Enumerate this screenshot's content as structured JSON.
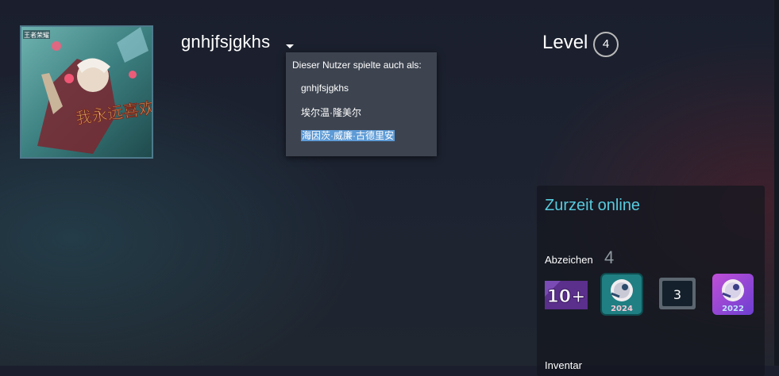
{
  "profile": {
    "persona_name": "gnhjfsjgkhs",
    "avatar_caption": "我永远喜欢 齐天",
    "avatar_logo": "王者荣耀"
  },
  "alias_popup": {
    "header": "Dieser Nutzer spielte auch als:",
    "aliases": [
      "gnhjfsjgkhs",
      "埃尔温·隆美尔",
      "海因茨·威廉·古德里安"
    ]
  },
  "level": {
    "label": "Level",
    "value": "4"
  },
  "side_panel": {
    "online_status": "Zurzeit online",
    "badges_label": "Abzeichen",
    "badges_count": "4",
    "badges": [
      {
        "icon": "badge-10-plus-icon",
        "text": "10+"
      },
      {
        "icon": "steam-2024-badge-icon",
        "text": "2024"
      },
      {
        "icon": "badge-3-icon",
        "text": "3"
      },
      {
        "icon": "steam-2022-badge-icon",
        "text": "2022"
      }
    ],
    "inventory_label": "Inventar"
  },
  "colors": {
    "online": "#57cbde",
    "popup_bg": "#3d4450",
    "selection": "#5e9bd6"
  }
}
